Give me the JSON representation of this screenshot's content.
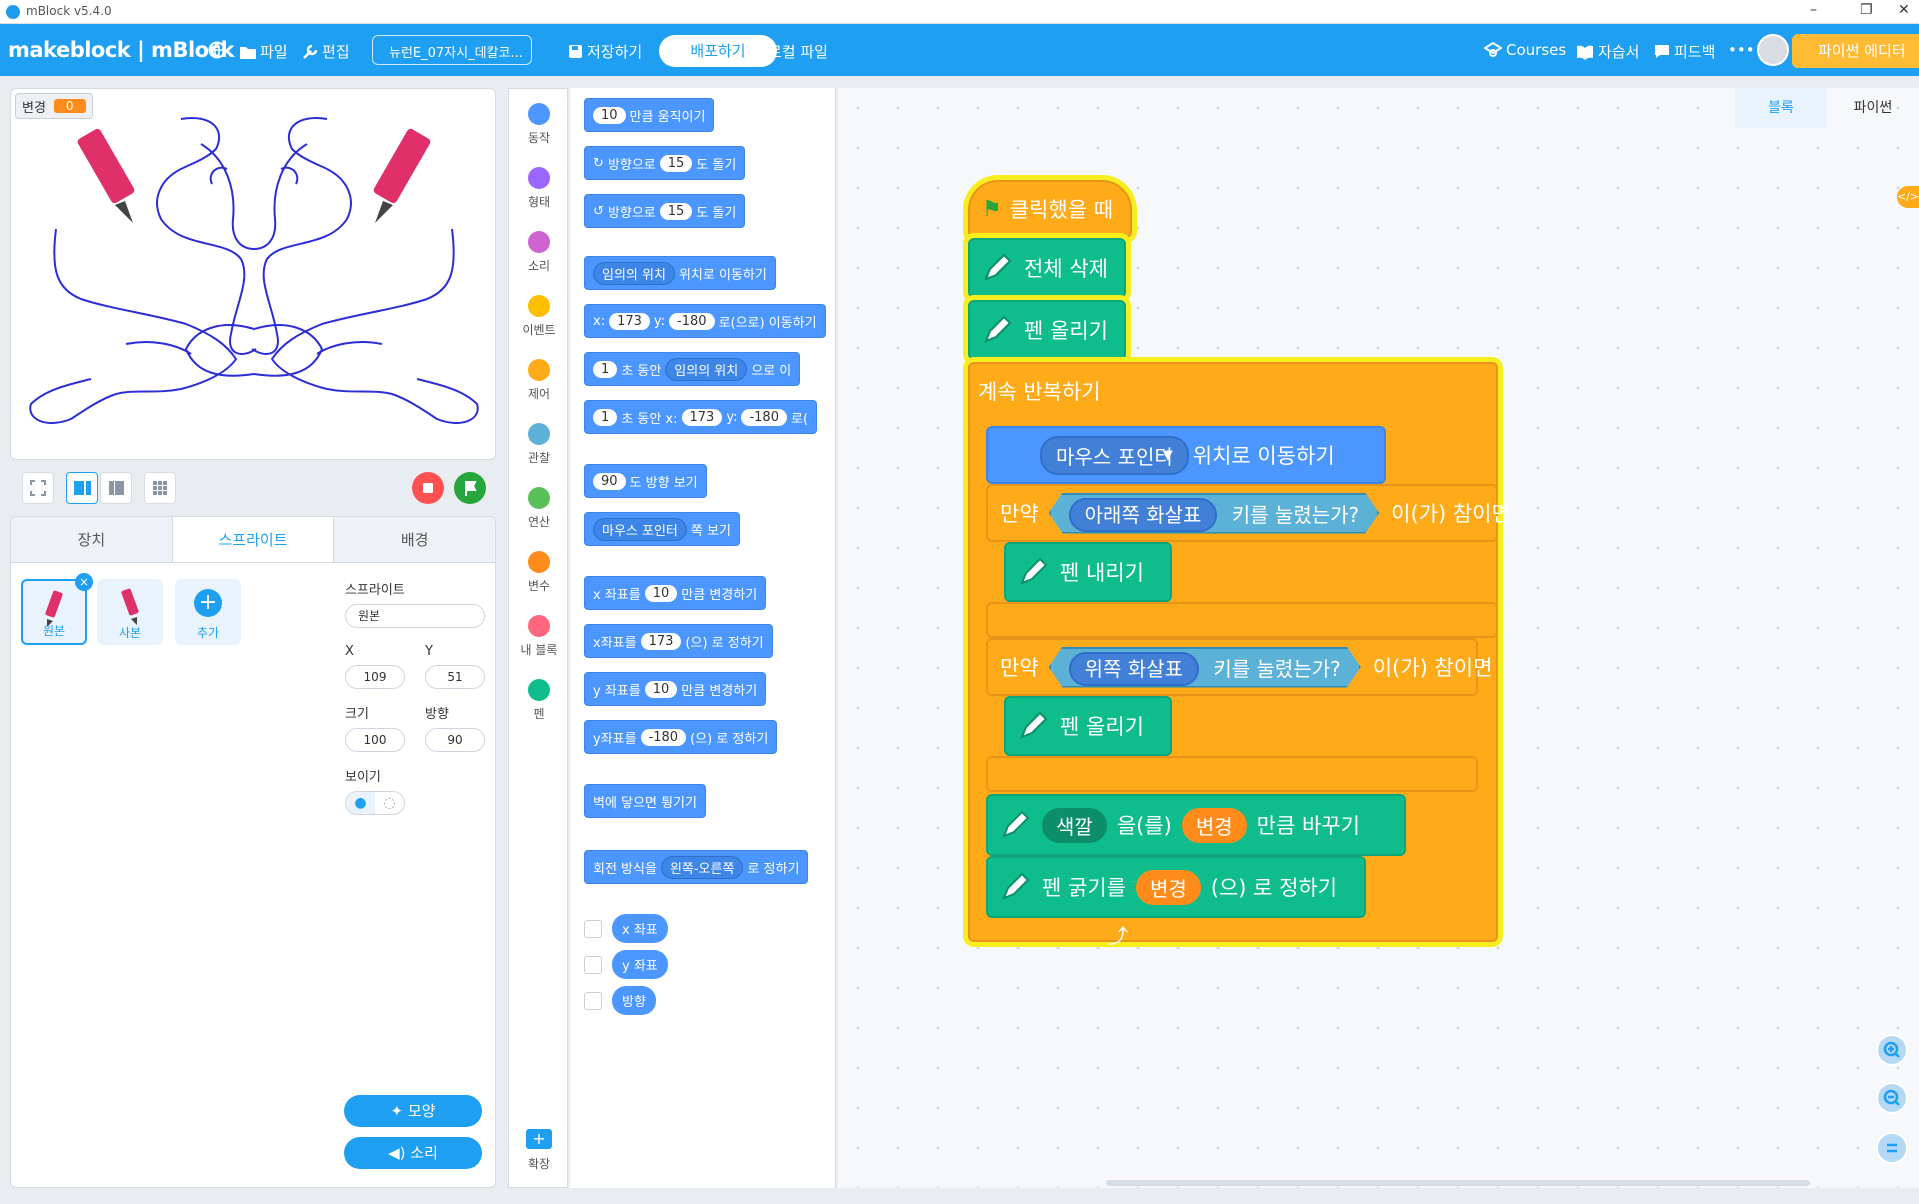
{
  "window": {
    "title": "mBlock v5.4.0",
    "min": "–",
    "restore": "❐",
    "close": "✕"
  },
  "topbar": {
    "brand": "makeblock | mBlock",
    "file": "파일",
    "edit": "편집",
    "project_name": "뉴런E_07자시_데칼코...",
    "save": "저장하기",
    "share": "배포하기",
    "local_file": "로컬 파일",
    "courses": "Courses",
    "tutorials": "자습서",
    "feedback": "피드백",
    "more": "•••",
    "python_editor": "파이썬 에디터"
  },
  "stage": {
    "monitor_label": "변경",
    "monitor_value": "0"
  },
  "sprite_panel": {
    "tabs": [
      "장치",
      "스프라이트",
      "배경"
    ],
    "sprites": [
      "원본",
      "사본"
    ],
    "add_label": "추가",
    "sprite_label": "스프라이트",
    "sprite_name": "원본",
    "x_label": "X",
    "y_label": "Y",
    "x": "109",
    "y": "51",
    "size_label": "크기",
    "dir_label": "방향",
    "size": "100",
    "direction": "90",
    "show_label": "보이기",
    "costume_btn": "모양",
    "sound_btn": "소리"
  },
  "categories": [
    {
      "label": "동작",
      "color": "#4c97ff"
    },
    {
      "label": "형태",
      "color": "#9966ff"
    },
    {
      "label": "소리",
      "color": "#cf63cf"
    },
    {
      "label": "이벤트",
      "color": "#ffbf00"
    },
    {
      "label": "제어",
      "color": "#ffab19"
    },
    {
      "label": "관찰",
      "color": "#5cb1d6"
    },
    {
      "label": "연산",
      "color": "#59c059"
    },
    {
      "label": "변수",
      "color": "#ff8c1a"
    },
    {
      "label": "내 블록",
      "color": "#ff6680"
    },
    {
      "label": "펜",
      "color": "#0fbd8c"
    }
  ],
  "extension_label": "확장",
  "palette": {
    "move_val": "10",
    "move_txt": "만큼 움직이기",
    "turn_r_pre": "방향으로",
    "turn_val": "15",
    "turn_txt": "도 돌기",
    "turn_l_pre": "방향으로",
    "goto_dd": "임의의 위치",
    "goto_txt": "위치로 이동하기",
    "xy_x": "x:",
    "xy_xval": "173",
    "xy_y": "y:",
    "xy_yval": "-180",
    "xy_txt": "로(으로) 이동하기",
    "glide_val": "1",
    "glide_txt": "초 동안",
    "glide_dd": "임의의 위치",
    "glide_txt2": "으로 이",
    "glide2_txt": "초 동안 x:",
    "glide2_x": "173",
    "glide2_y": "y:",
    "glide2_yval": "-180",
    "glide2_txt2": "로(",
    "point_val": "90",
    "point_txt": "도 방향 보기",
    "towards_dd": "마우스 포인터",
    "towards_txt": "쪽 보기",
    "chx_pre": "x 좌표를",
    "chx_val": "10",
    "chx_txt": "만큼 변경하기",
    "setx_pre": "x좌표를",
    "setx_val": "173",
    "setx_txt": "(으) 로 정하기",
    "chy_pre": "y 좌표를",
    "chy_val": "10",
    "chy_txt": "만큼 변경하기",
    "sety_pre": "y좌표를",
    "sety_val": "-180",
    "sety_txt": "(으) 로 정하기",
    "bounce": "벽에 닿으면 튕기기",
    "rot_pre": "회전 방식을",
    "rot_dd": "왼쪽-오른쪽",
    "rot_txt": "로 정하기",
    "rep_x": "x 좌표",
    "rep_y": "y 좌표",
    "rep_dir": "방향"
  },
  "workspace": {
    "tab_blocks": "블록",
    "tab_python": "파이썬",
    "hat": "클릭했을 때",
    "clear": "전체 삭제",
    "penup": "펜 올리기",
    "forever": "계속 반복하기",
    "goto_dd": "마우스 포인터",
    "goto_txt": "위치로 이동하기",
    "if1_pre": "만약",
    "if1_key": "아래쪽 화살표",
    "if1_cond": "키를 눌렸는가?",
    "if1_post": "이(가) 참이면",
    "pendown": "펜 내리기",
    "if2_pre": "만약",
    "if2_key": "위쪽 화살표",
    "if2_cond": "키를 눌렸는가?",
    "if2_post": "이(가) 참이면",
    "penup2": "펜 올리기",
    "chg_dd": "색깔",
    "chg_mid": "을(를)",
    "chg_var": "변경",
    "chg_txt": "만큼 바꾸기",
    "size_pre": "펜 굵기를",
    "size_var": "변경",
    "size_txt": "(으) 로 정하기"
  }
}
